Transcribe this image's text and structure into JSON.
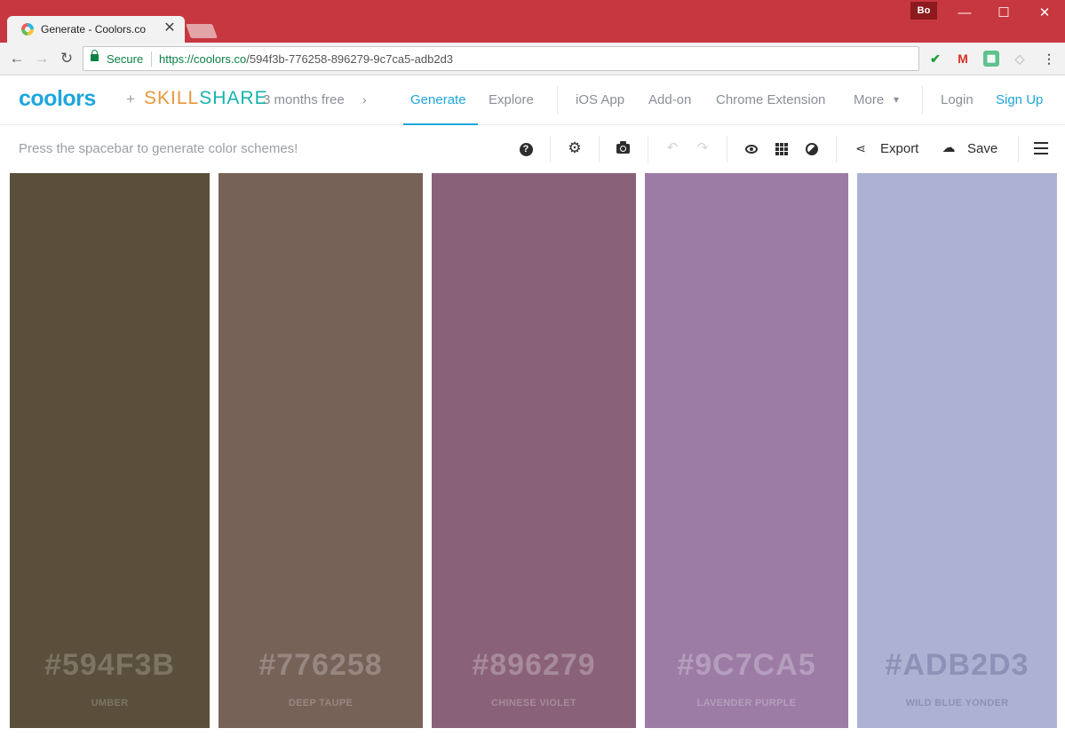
{
  "browser": {
    "tab_title": "Generate - Coolors.co",
    "profile": "Bo",
    "secure_label": "Secure",
    "url_host": "https://coolors.co",
    "url_path": "/594f3b-776258-896279-9c7ca5-adb2d3"
  },
  "site": {
    "logo": "coolors",
    "plus": "+",
    "partner_prefix": "SKILL",
    "partner_suffix": "SHARE",
    "promo": "3 months free",
    "nav": {
      "generate": "Generate",
      "explore": "Explore",
      "ios_app": "iOS App",
      "add_on": "Add-on",
      "chrome_extension": "Chrome Extension",
      "more": "More",
      "login": "Login",
      "sign_up": "Sign Up"
    },
    "accent_color": "#1fa6dc"
  },
  "toolbar": {
    "hint": "Press the spacebar to generate color schemes!",
    "export_label": "Export",
    "save_label": "Save"
  },
  "palette": [
    {
      "hex": "#594F3B",
      "name": "UMBER",
      "color": "#594f3b",
      "text_color": "#7d7463"
    },
    {
      "hex": "#776258",
      "name": "DEEP TAUPE",
      "color": "#776258",
      "text_color": "#978780"
    },
    {
      "hex": "#896279",
      "name": "CHINESE VIOLET",
      "color": "#896279",
      "text_color": "#a78a9c"
    },
    {
      "hex": "#9C7CA5",
      "name": "LAVENDER PURPLE",
      "color": "#9c7ca5",
      "text_color": "#b59ebd"
    },
    {
      "hex": "#ADB2D3",
      "name": "WILD BLUE YONDER",
      "color": "#adb2d3",
      "text_color": "#8c92b6"
    }
  ]
}
